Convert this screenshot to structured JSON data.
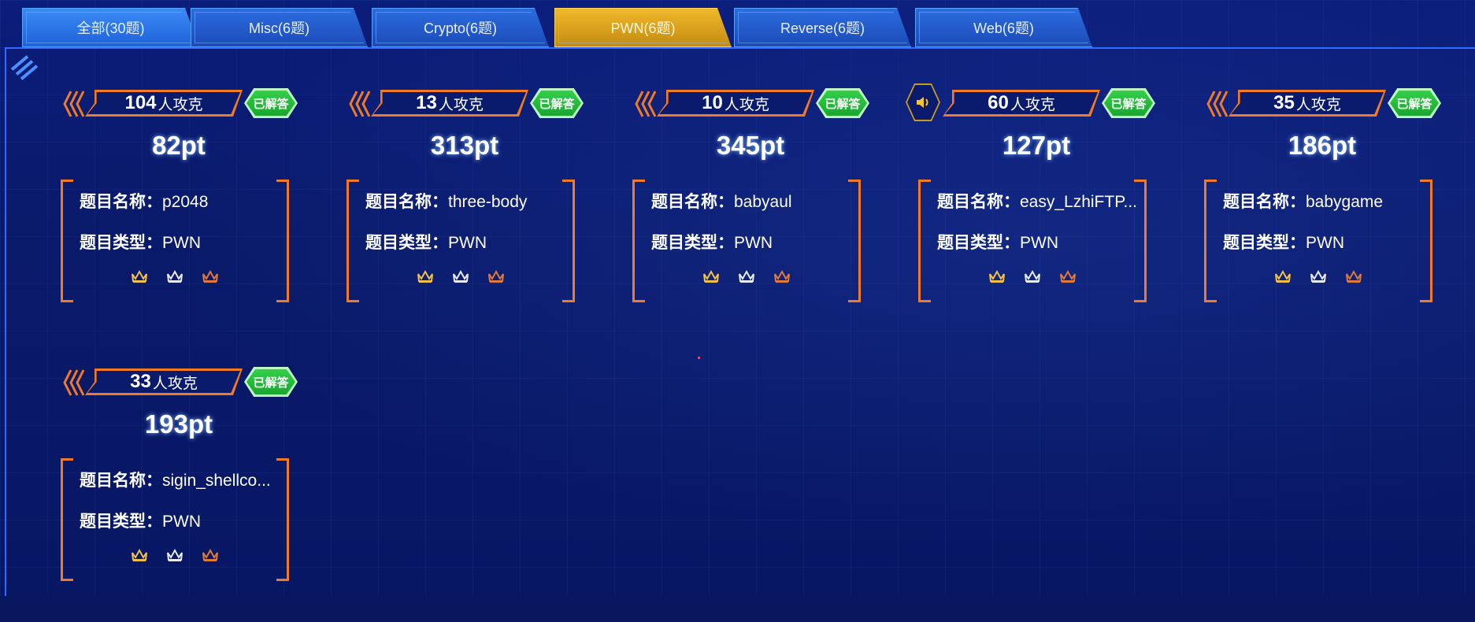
{
  "tabs": [
    {
      "label": "全部(30题)"
    },
    {
      "label": "Misc(6题)"
    },
    {
      "label": "Crypto(6题)"
    },
    {
      "label": "PWN(6题)"
    },
    {
      "label": "Reverse(6题)"
    },
    {
      "label": "Web(6题)"
    }
  ],
  "active_tab_index": 3,
  "labels": {
    "solvers_suffix": "人攻克",
    "solved_badge": "已解答",
    "name_key": "题目名称：",
    "type_key": "题目类型："
  },
  "cards": [
    {
      "solvers": "104",
      "points": "82pt",
      "name": "p2048",
      "type": "PWN"
    },
    {
      "solvers": "13",
      "points": "313pt",
      "name": "three-body",
      "type": "PWN"
    },
    {
      "solvers": "10",
      "points": "345pt",
      "name": "babyaul",
      "type": "PWN"
    },
    {
      "solvers": "60",
      "points": "127pt",
      "name": "easy_LzhiFTP...",
      "type": "PWN"
    },
    {
      "solvers": "35",
      "points": "186pt",
      "name": "babygame",
      "type": "PWN"
    },
    {
      "solvers": "33",
      "points": "193pt",
      "name": "sigin_shellco...",
      "type": "PWN"
    }
  ],
  "icons": {
    "crowns": [
      "gold-crown-icon",
      "silver-crown-icon",
      "bronze-crown-icon"
    ],
    "speaker": "speaker-icon"
  },
  "colors": {
    "accent_orange": "#f17a23",
    "solved_green": "#1fb736",
    "active_tab_gold": "#e0a822",
    "tab_blue": "#2a66d6",
    "background": "#0a1a6a"
  }
}
